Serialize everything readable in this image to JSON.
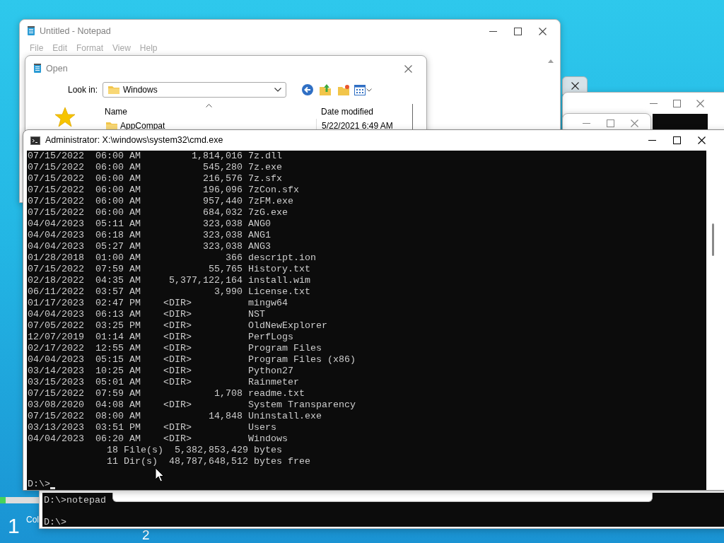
{
  "desktop": {
    "labels": [
      "1",
      "Col",
      "2"
    ]
  },
  "notepad": {
    "title": "Untitled - Notepad",
    "menu": [
      {
        "label": "File",
        "disabled": true
      },
      {
        "label": "Edit",
        "disabled": true
      },
      {
        "label": "Format",
        "disabled": true
      },
      {
        "label": "View",
        "disabled": true
      },
      {
        "label": "Help",
        "disabled": true
      }
    ]
  },
  "open_dialog": {
    "title": "Open",
    "look_in_label": "Look in:",
    "look_in_value": "Windows",
    "columns": [
      "Name",
      "Date modified"
    ],
    "rows": [
      {
        "name": "AppCompat",
        "date_modified": "5/22/2021 6:49 AM"
      }
    ]
  },
  "cmd": {
    "title": "Administrator: X:\\windows\\system32\\cmd.exe",
    "lines": [
      "07/15/2022  06:00 AM         1,814,016 7z.dll",
      "07/15/2022  06:00 AM           545,280 7z.exe",
      "07/15/2022  06:00 AM           216,576 7z.sfx",
      "07/15/2022  06:00 AM           196,096 7zCon.sfx",
      "07/15/2022  06:00 AM           957,440 7zFM.exe",
      "07/15/2022  06:00 AM           684,032 7zG.exe",
      "04/04/2023  05:11 AM           323,038 ANG0",
      "04/04/2023  06:18 AM           323,038 ANG1",
      "04/04/2023  05:27 AM           323,038 ANG3",
      "01/28/2018  01:00 AM               366 descript.ion",
      "07/15/2022  07:59 AM            55,765 History.txt",
      "02/18/2022  04:35 AM     5,377,122,164 install.wim",
      "06/11/2022  03:57 AM             3,990 License.txt",
      "01/17/2023  02:47 PM    <DIR>          mingw64",
      "04/04/2023  06:13 AM    <DIR>          NST",
      "07/05/2022  03:25 PM    <DIR>          OldNewExplorer",
      "12/07/2019  01:14 AM    <DIR>          PerfLogs",
      "02/17/2022  12:55 AM    <DIR>          Program Files",
      "04/04/2023  05:15 AM    <DIR>          Program Files (x86)",
      "03/14/2023  10:25 AM    <DIR>          Python27",
      "03/15/2023  05:01 AM    <DIR>          Rainmeter",
      "07/15/2022  07:59 AM             1,708 readme.txt",
      "03/08/2020  04:08 AM    <DIR>          System Transparency",
      "07/15/2022  08:00 AM            14,848 Uninstall.exe",
      "03/13/2023  03:51 PM    <DIR>          Users",
      "04/04/2023  06:20 AM    <DIR>          Windows",
      "              18 File(s)  5,382,853,429 bytes",
      "              11 Dir(s)  48,787,648,512 bytes free"
    ],
    "prompt": "D:\\>"
  },
  "back_console": {
    "lines": [
      "D:\\>notepad",
      "D:\\>"
    ]
  }
}
